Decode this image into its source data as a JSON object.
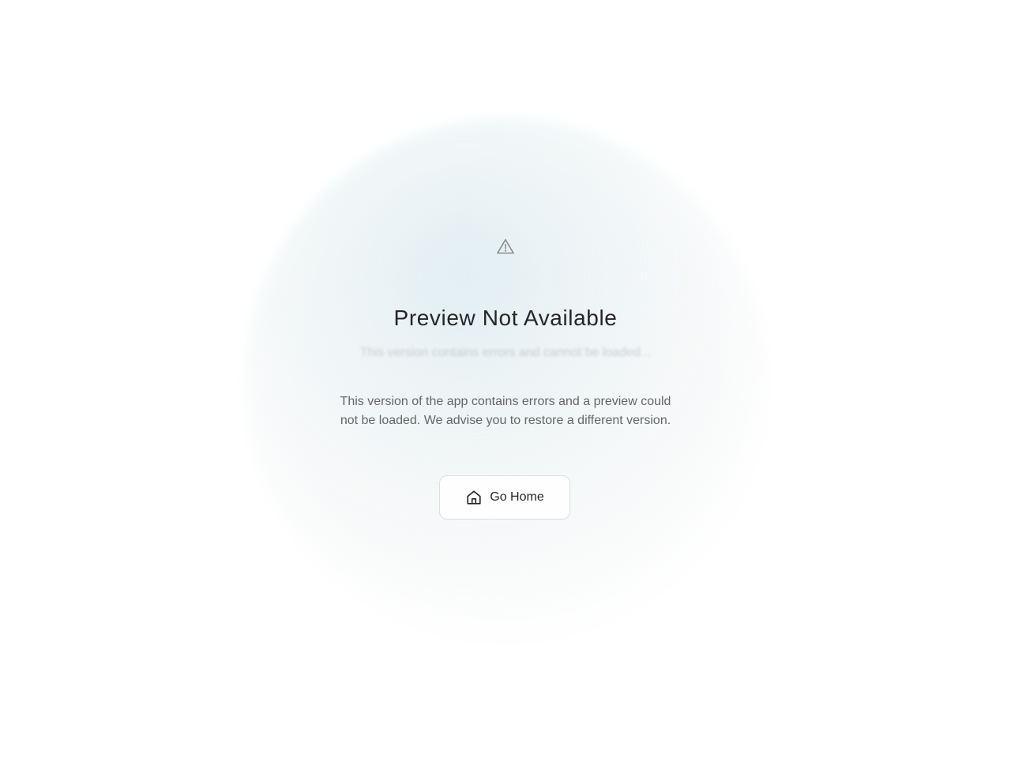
{
  "error_page": {
    "title": "Preview Not Available",
    "subtitle": "This version contains errors and cannot be loaded...",
    "description": "This version of the app contains errors and a preview could not be loaded. We advise you to restore a different version.",
    "home_button_label": "Go Home"
  },
  "icons": {
    "warning": "warning-triangle-icon",
    "home": "home-icon"
  },
  "colors": {
    "title": "#262626",
    "description": "#666666",
    "button_border": "#dddddd",
    "glow": "#cfe4ea"
  }
}
